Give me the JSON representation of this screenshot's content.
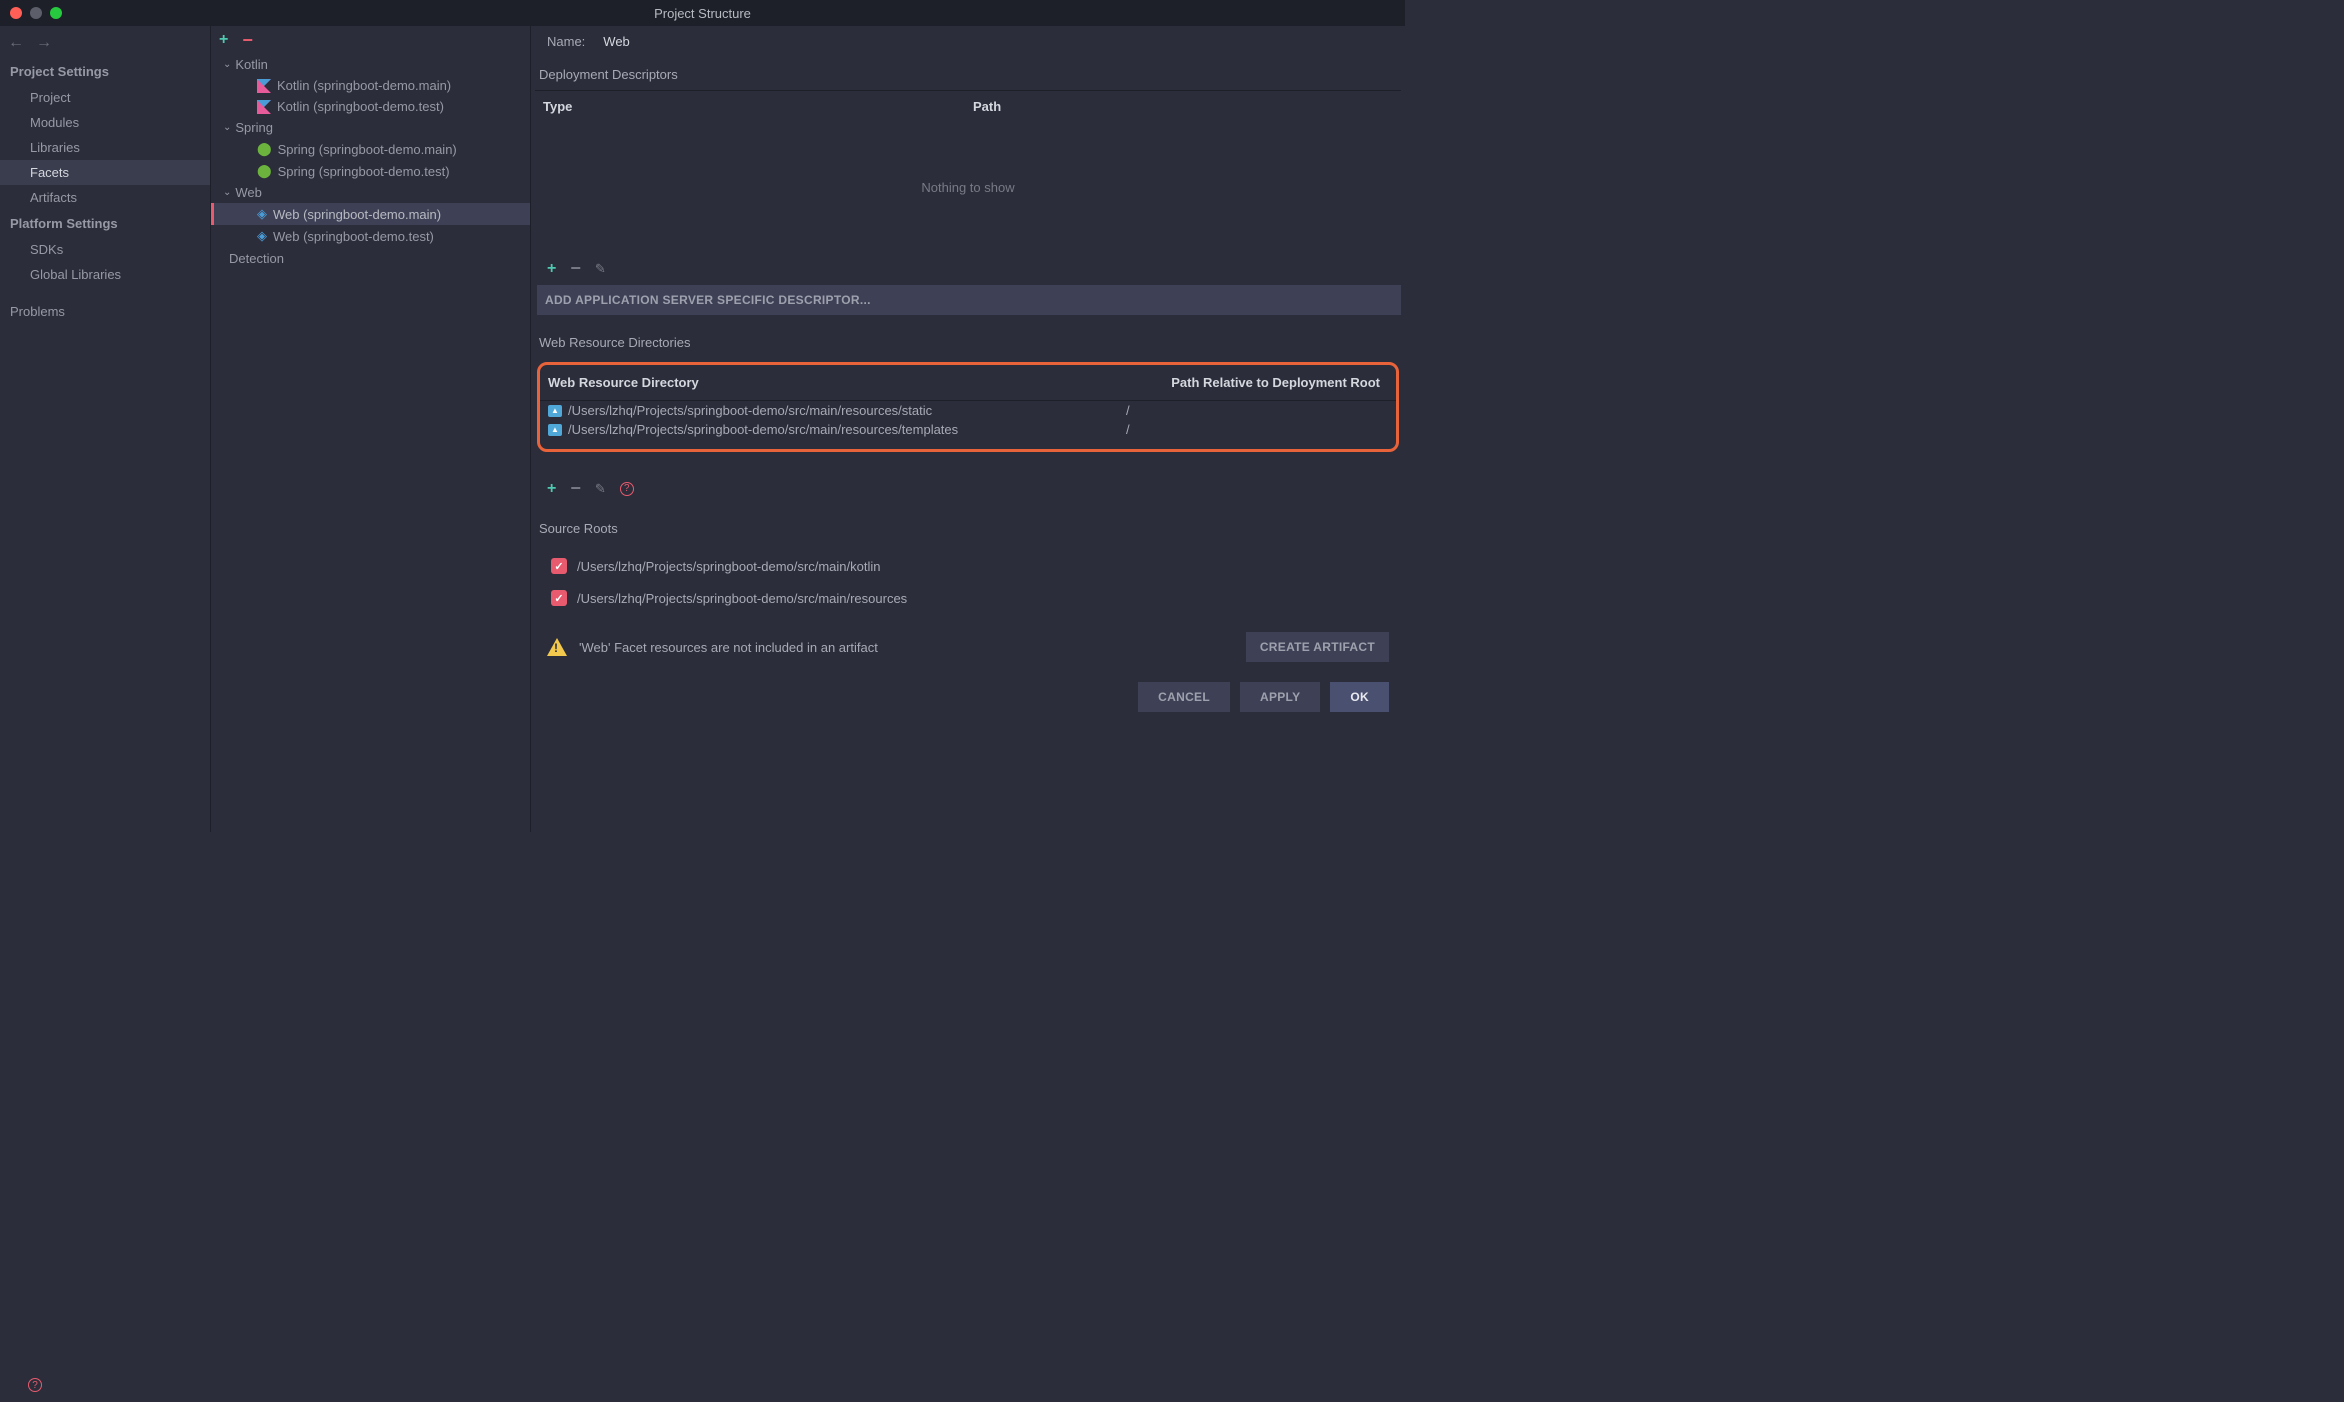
{
  "title": "Project Structure",
  "sidebar": {
    "section1": "Project Settings",
    "items1": [
      "Project",
      "Modules",
      "Libraries",
      "Facets",
      "Artifacts"
    ],
    "section2": "Platform Settings",
    "items2": [
      "SDKs",
      "Global Libraries"
    ],
    "problems": "Problems"
  },
  "tree": {
    "groups": [
      {
        "label": "Kotlin",
        "items": [
          "Kotlin (springboot-demo.main)",
          "Kotlin (springboot-demo.test)"
        ]
      },
      {
        "label": "Spring",
        "items": [
          "Spring (springboot-demo.main)",
          "Spring (springboot-demo.test)"
        ]
      },
      {
        "label": "Web",
        "items": [
          "Web (springboot-demo.main)",
          "Web (springboot-demo.test)"
        ]
      }
    ],
    "detection": "Detection"
  },
  "right": {
    "nameLabel": "Name:",
    "nameValue": "Web",
    "deployDesc": "Deployment Descriptors",
    "colType": "Type",
    "colPath": "Path",
    "nothing": "Nothing to show",
    "addDescriptor": "ADD APPLICATION SERVER SPECIFIC DESCRIPTOR...",
    "wrdTitle": "Web Resource Directories",
    "wrdCol1": "Web Resource Directory",
    "wrdCol2": "Path Relative to Deployment Root",
    "wrdRows": [
      {
        "dir": "/Users/lzhq/Projects/springboot-demo/src/main/resources/static",
        "rel": "/"
      },
      {
        "dir": "/Users/lzhq/Projects/springboot-demo/src/main/resources/templates",
        "rel": "/"
      }
    ],
    "sourceRootsTitle": "Source Roots",
    "sourceRoots": [
      "/Users/lzhq/Projects/springboot-demo/src/main/kotlin",
      "/Users/lzhq/Projects/springboot-demo/src/main/resources"
    ],
    "warning": "'Web' Facet resources are not included in an artifact",
    "createArtifact": "CREATE ARTIFACT"
  },
  "buttons": {
    "cancel": "CANCEL",
    "apply": "APPLY",
    "ok": "OK"
  }
}
